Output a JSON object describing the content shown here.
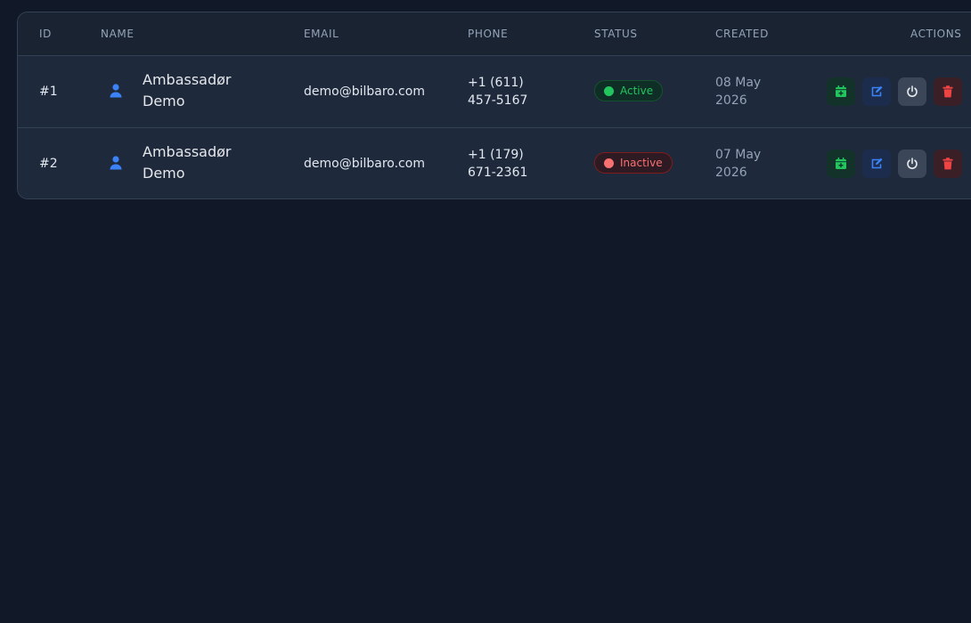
{
  "table": {
    "columns": {
      "id": "ID",
      "name": "NAME",
      "email": "EMAIL",
      "phone": "PHONE",
      "status": "STATUS",
      "created": "CREATED",
      "actions": "ACTIONS"
    },
    "rows": [
      {
        "id": "#1",
        "name_line1": "Ambassadør",
        "name_line2": "Demo",
        "email": "demo@bilbaro.com",
        "phone_line1": "+1 (611)",
        "phone_line2": "457-5167",
        "status": "Active",
        "created_line1": "08 May",
        "created_line2": "2026"
      },
      {
        "id": "#2",
        "name_line1": "Ambassadør",
        "name_line2": "Demo",
        "email": "demo@bilbaro.com",
        "phone_line1": "+1 (179)",
        "phone_line2": "671-2361",
        "status": "Inactive",
        "created_line1": "07 May",
        "created_line2": "2026"
      }
    ]
  },
  "icons": {
    "user": "user-icon",
    "schedule": "calendar-plus-icon",
    "edit": "edit-icon",
    "power": "power-icon",
    "delete": "trash-icon"
  },
  "colors": {
    "background": "#111827",
    "card": "#1e293b",
    "active": "#22c55e",
    "inactive": "#f87171",
    "accent_blue": "#3b82f6"
  }
}
